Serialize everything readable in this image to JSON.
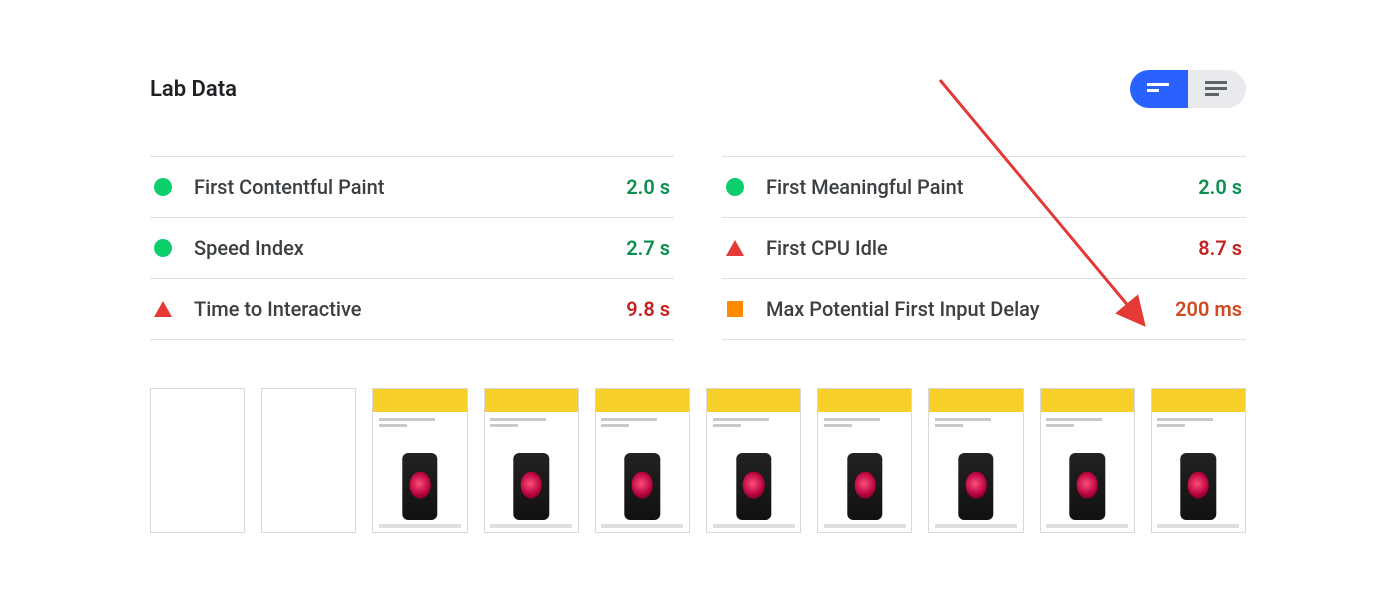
{
  "header": {
    "title": "Lab Data",
    "view_active": "summary"
  },
  "metrics_left": [
    {
      "status": "pass",
      "label": "First Contentful Paint",
      "value": "2.0 s",
      "tone": "pass"
    },
    {
      "status": "pass",
      "label": "Speed Index",
      "value": "2.7 s",
      "tone": "pass"
    },
    {
      "status": "fail",
      "label": "Time to Interactive",
      "value": "9.8 s",
      "tone": "fail"
    }
  ],
  "metrics_right": [
    {
      "status": "pass",
      "label": "First Meaningful Paint",
      "value": "2.0 s",
      "tone": "pass"
    },
    {
      "status": "fail",
      "label": "First CPU Idle",
      "value": "8.7 s",
      "tone": "fail"
    },
    {
      "status": "avg",
      "label": "Max Potential First Input Delay",
      "value": "200 ms",
      "tone": "avg"
    }
  ],
  "filmstrip": {
    "frames": [
      {
        "state": "blank"
      },
      {
        "state": "blank"
      },
      {
        "state": "loaded"
      },
      {
        "state": "loaded"
      },
      {
        "state": "loaded"
      },
      {
        "state": "loaded"
      },
      {
        "state": "loaded"
      },
      {
        "state": "loaded"
      },
      {
        "state": "loaded"
      },
      {
        "state": "loaded"
      }
    ]
  },
  "colors": {
    "accent": "#2962ff",
    "pass": "#0cce6b",
    "avg": "#ff8a00",
    "fail": "#e53935"
  }
}
